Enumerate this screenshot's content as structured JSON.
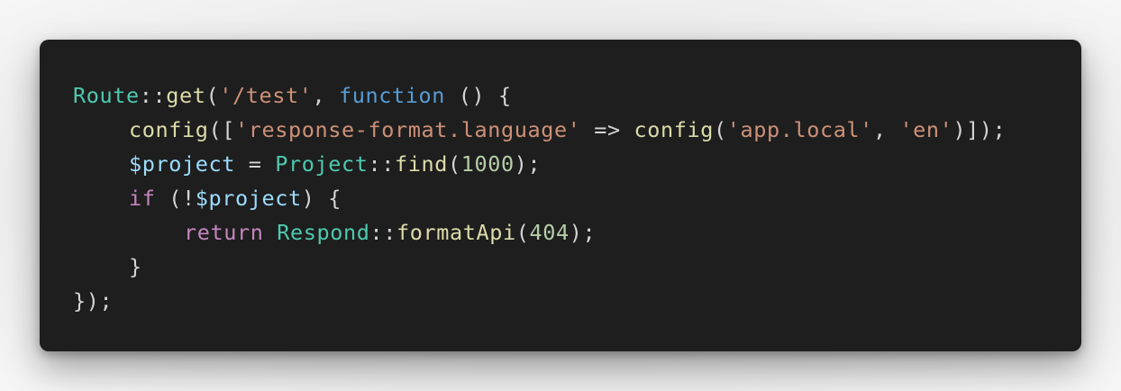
{
  "code": {
    "language": "php",
    "theme": {
      "background": "#1e1e1e",
      "default": "#d4d4d4",
      "type": "#4ec9b0",
      "function": "#dcdcaa",
      "string": "#ce9178",
      "keyword": "#569cd6",
      "control": "#c586c0",
      "variable": "#9cdcfe",
      "number": "#b5cea8"
    },
    "lines": [
      {
        "indent": 0,
        "tokens": [
          {
            "text": "Route",
            "kind": "type"
          },
          {
            "text": "::",
            "kind": "default"
          },
          {
            "text": "get",
            "kind": "function"
          },
          {
            "text": "(",
            "kind": "default"
          },
          {
            "text": "'/test'",
            "kind": "string"
          },
          {
            "text": ", ",
            "kind": "default"
          },
          {
            "text": "function",
            "kind": "keyword"
          },
          {
            "text": " () {",
            "kind": "default"
          }
        ]
      },
      {
        "indent": 1,
        "tokens": [
          {
            "text": "config",
            "kind": "function"
          },
          {
            "text": "([",
            "kind": "default"
          },
          {
            "text": "'response-format.language'",
            "kind": "string"
          },
          {
            "text": " => ",
            "kind": "default"
          },
          {
            "text": "config",
            "kind": "function"
          },
          {
            "text": "(",
            "kind": "default"
          },
          {
            "text": "'app.local'",
            "kind": "string"
          },
          {
            "text": ", ",
            "kind": "default"
          },
          {
            "text": "'en'",
            "kind": "string"
          },
          {
            "text": ")]);",
            "kind": "default"
          }
        ]
      },
      {
        "indent": 1,
        "tokens": [
          {
            "text": "$project",
            "kind": "variable"
          },
          {
            "text": " = ",
            "kind": "default"
          },
          {
            "text": "Project",
            "kind": "type"
          },
          {
            "text": "::",
            "kind": "default"
          },
          {
            "text": "find",
            "kind": "function"
          },
          {
            "text": "(",
            "kind": "default"
          },
          {
            "text": "1000",
            "kind": "number"
          },
          {
            "text": ");",
            "kind": "default"
          }
        ]
      },
      {
        "indent": 1,
        "tokens": [
          {
            "text": "if",
            "kind": "control"
          },
          {
            "text": " (!",
            "kind": "default"
          },
          {
            "text": "$project",
            "kind": "variable"
          },
          {
            "text": ") {",
            "kind": "default"
          }
        ]
      },
      {
        "indent": 2,
        "tokens": [
          {
            "text": "return",
            "kind": "control"
          },
          {
            "text": " ",
            "kind": "default"
          },
          {
            "text": "Respond",
            "kind": "type"
          },
          {
            "text": "::",
            "kind": "default"
          },
          {
            "text": "formatApi",
            "kind": "function"
          },
          {
            "text": "(",
            "kind": "default"
          },
          {
            "text": "404",
            "kind": "number"
          },
          {
            "text": ");",
            "kind": "default"
          }
        ]
      },
      {
        "indent": 1,
        "tokens": [
          {
            "text": "}",
            "kind": "default"
          }
        ]
      },
      {
        "indent": 0,
        "tokens": [
          {
            "text": "});",
            "kind": "default"
          }
        ]
      }
    ]
  }
}
